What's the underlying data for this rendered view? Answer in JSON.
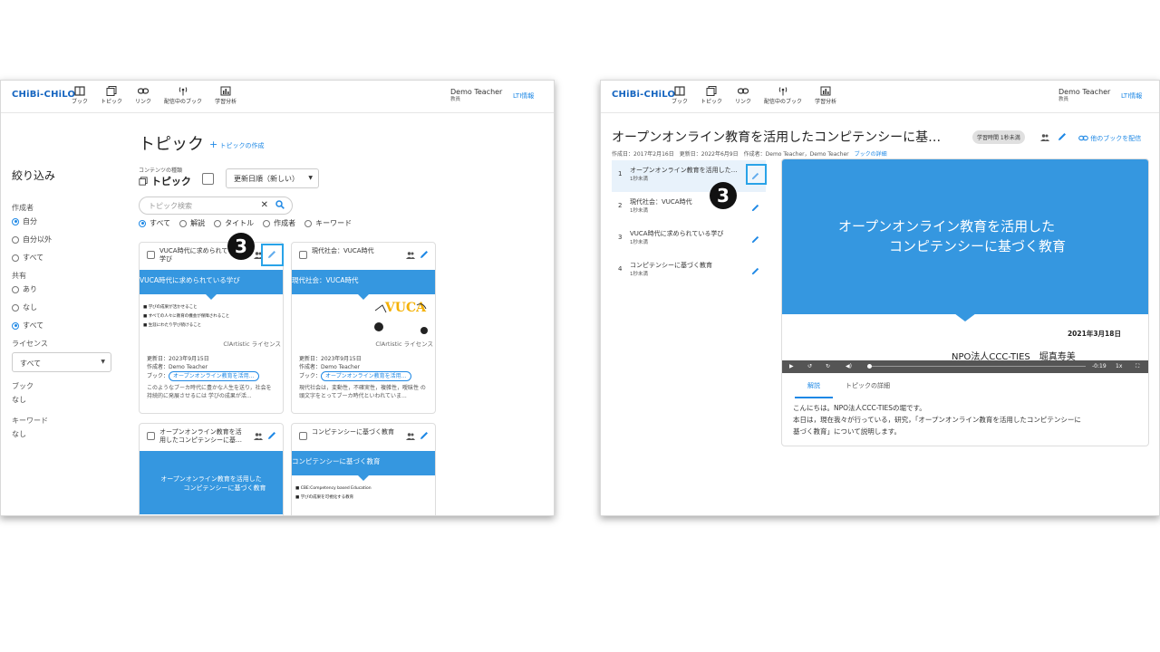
{
  "step_number": "3",
  "common": {
    "logo": "CHiBi-CHiLO",
    "nav": [
      "ブック",
      "トピック",
      "リンク",
      "配信中のブック",
      "学習分析"
    ],
    "user_name": "Demo Teacher",
    "user_role": "教員",
    "lti": "LTI情報"
  },
  "left": {
    "sidebar": {
      "title": "絞り込み",
      "author_label": "作成者",
      "author_options": [
        "自分",
        "自分以外",
        "すべて"
      ],
      "share_label": "共有",
      "share_options": [
        "あり",
        "なし",
        "すべて"
      ],
      "license_label": "ライセンス",
      "license_value": "すべて",
      "book_label": "ブック",
      "book_value": "なし",
      "keyword_label": "キーワード",
      "keyword_value": "なし"
    },
    "page_title": "トピック",
    "add_link": "トピックの作成",
    "content_type_label": "コンテンツの種類",
    "content_type_value": "トピック",
    "sort_value": "更新日順（新しい）",
    "search_placeholder": "トピック検索",
    "filter_options": [
      "すべて",
      "解説",
      "タイトル",
      "作成者",
      "キーワード"
    ],
    "cards": [
      {
        "title": "VUCA時代に求められている学び",
        "banner": "VUCA時代に求められている学び",
        "bullets": [
          "学びの成果が活かせること",
          "すべての人々に教育の機会が保障されること",
          "生涯にわたり学び続けること"
        ],
        "license": "ClArtistic ライセンス",
        "updated": "更新日：2023年9月15日",
        "author": "作成者：Demo Teacher",
        "book_label": "ブック：",
        "book": "オープンオンライン教育を活用…",
        "desc": "このようなブーカ時代に豊かな人生を送り，社会を持続的に発展させるには 学びの成果が活..."
      },
      {
        "title": "現代社会：VUCA時代",
        "banner": "現代社会：VUCA時代",
        "vuca": "VUCA",
        "license": "ClArtistic ライセンス",
        "updated": "更新日：2023年9月15日",
        "author": "作成者：Demo Teacher",
        "book_label": "ブック：",
        "book": "オープンオンライン教育を活用…",
        "desc": "現代社会は，変動性，不確実性，複雑性，曖昧性 の頭文字をとってブーカ時代といわれていま..."
      },
      {
        "title": "オープンオンライン教育を活用したコンピテンシーに基…",
        "banner_line1": "オープンオンライン教育を活用した",
        "banner_line2": "コンピテンシーに基づく教育"
      },
      {
        "title": "コンピテンシーに基づく教育",
        "banner": "コンピテンシーに基づく教育",
        "bullets": [
          "CBE:Competency based Education",
          "学びの成果を可視化する教育"
        ]
      }
    ]
  },
  "right": {
    "book_title": "オープンオンライン教育を活用したコンピテンシーに基…",
    "badge": "学習時間 1秒未満",
    "meta": "作成日：2017年2月16日　更新日：2022年6月9日　作成者：Demo Teacher，Demo Teacher",
    "meta_link": "ブックの詳細",
    "deliver": "他のブックを配信",
    "topics": [
      {
        "num": "1",
        "title": "オープンオンライン教育を活用した…",
        "time": "1秒未満"
      },
      {
        "num": "2",
        "title": "現代社会：VUCA時代",
        "time": "1秒未満"
      },
      {
        "num": "3",
        "title": "VUCA時代に求められている学び",
        "time": "1秒未満"
      },
      {
        "num": "4",
        "title": "コンピテンシーに基づく教育",
        "time": "1秒未満"
      }
    ],
    "video": {
      "line1": "オープンオンライン教育を活用した",
      "line2": "コンピテンシーに基づく教育",
      "date": "2021年3月18日",
      "org": "NPO法人CCC-TIES　堀真寿美",
      "time": "-0:19",
      "speed": "1x"
    },
    "tabs": [
      "解説",
      "トピックの詳細"
    ],
    "text_lines": [
      "こんにちは。NPO法人CCC-TIESの堀です。",
      "本日は，現在我々が行っている，研究，「オープンオンライン教育を活用したコンピテンシーに",
      "基づく教育」について説明します。"
    ]
  }
}
